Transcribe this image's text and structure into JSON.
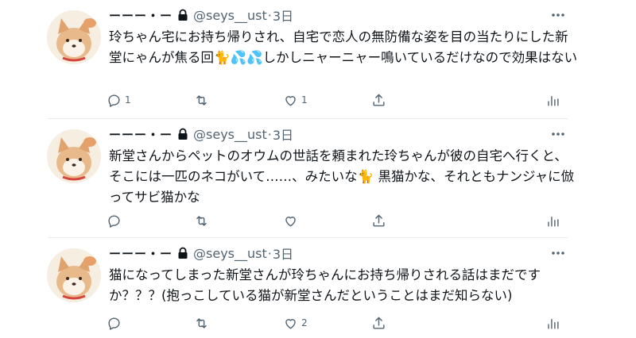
{
  "tweets": [
    {
      "display_name": "ーーー・ー",
      "handle": "@seys__ust",
      "separator": "·",
      "time": "3日",
      "text": "玲ちゃん宅にお持ち帰りされ、自宅で恋人の無防備な姿を目の当たりにした新堂にゃんが焦る回🐈💦💦しかしニャーニャー鳴いているだけなので効果はない",
      "reply_count": "1",
      "retweet_count": "",
      "like_count": "1"
    },
    {
      "display_name": "ーーー・ー",
      "handle": "@seys__ust",
      "separator": "·",
      "time": "3日",
      "text": "新堂さんからペットのオウムの世話を頼まれた玲ちゃんが彼の自宅へ行くと、そこには一匹のネコがいて……、みたいな🐈 黒猫かな、それともナンジャに倣ってサビ猫かな",
      "reply_count": "",
      "retweet_count": "",
      "like_count": ""
    },
    {
      "display_name": "ーーー・ー",
      "handle": "@seys__ust",
      "separator": "·",
      "time": "3日",
      "text": "猫になってしまった新堂さんが玲ちゃんにお持ち帰りされる話はまだですか？？？(抱っこしている猫が新堂さんだということはまだ知らない)",
      "reply_count": "",
      "retweet_count": "",
      "like_count": "2"
    }
  ],
  "icons": {
    "avatar": "shiba-dog-avatar",
    "lock": "lock-icon",
    "more": "more-icon",
    "reply": "reply-icon",
    "retweet": "retweet-icon",
    "like": "heart-icon",
    "share": "share-icon",
    "analytics": "analytics-icon"
  },
  "colors": {
    "text": "#0f1419",
    "secondary": "#536471",
    "divider": "#e6ecf0"
  }
}
